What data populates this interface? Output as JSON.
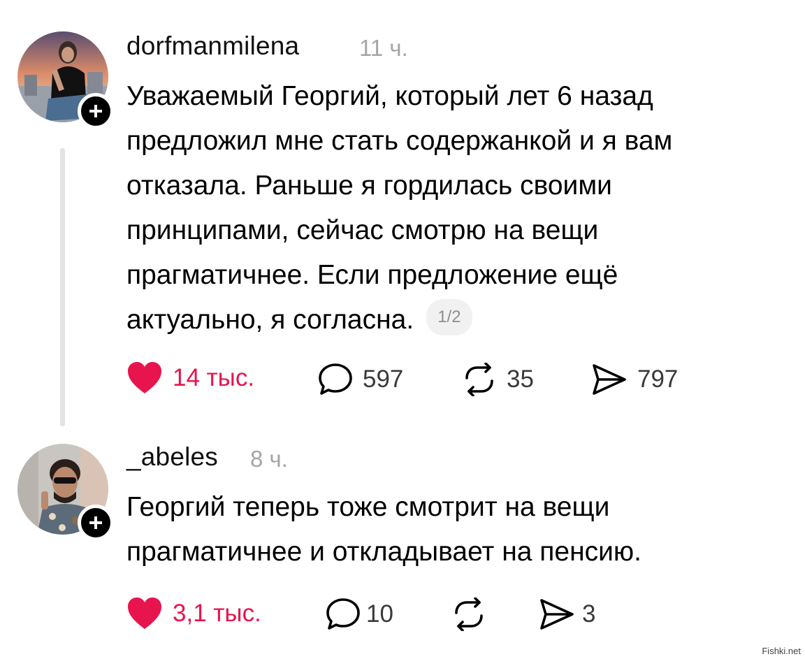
{
  "posts": [
    {
      "username": "dorfmanmilena",
      "time": "11 ч.",
      "text_lines": [
        "Уважаемый Георгий, который лет 6 назад",
        "предложил мне стать содержанкой и я вам",
        "отказала. Раньше я гордилась своими",
        "принципами, сейчас смотрю на вещи",
        "прагматичнее. Если предложение ещё",
        "актуально, я согласна."
      ],
      "page_indicator": "1/2",
      "likes": "14 тыс.",
      "comments": "597",
      "reposts": "35",
      "shares": "797"
    },
    {
      "username": "_abeles",
      "time": "8 ч.",
      "text_lines": [
        "Георгий теперь тоже смотрит на вещи",
        "прагматичнее и откладывает на пенсию."
      ],
      "likes": "3,1 тыс.",
      "comments": "10",
      "reposts": "",
      "shares": "3"
    }
  ],
  "icons": {
    "like": "heart-icon",
    "comment": "speech-bubble-icon",
    "repost": "repost-arrows-icon",
    "share": "send-paper-plane-icon",
    "follow": "plus-icon"
  },
  "colors": {
    "like_accent": "#e8144d",
    "muted_text": "#a5a5a5",
    "thread_line": "#e3e3e3"
  },
  "watermark": "Fishki.net"
}
